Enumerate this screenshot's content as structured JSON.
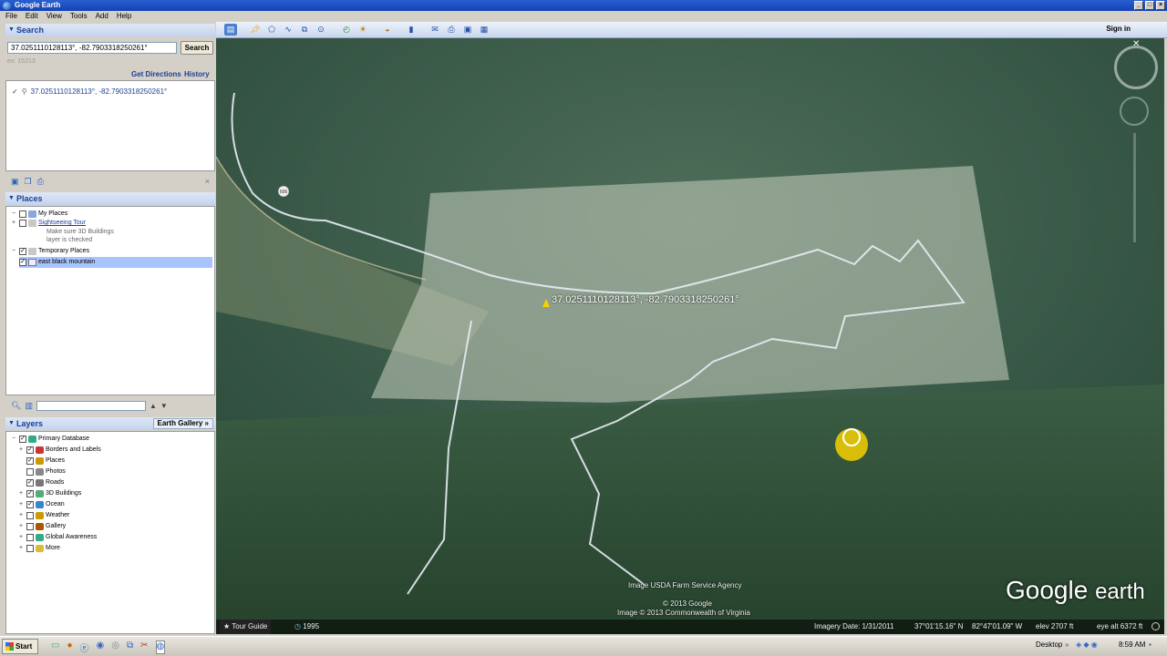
{
  "window": {
    "title": "Google Earth",
    "controls": [
      "_",
      "□",
      "×"
    ]
  },
  "menu": [
    "File",
    "Edit",
    "View",
    "Tools",
    "Add",
    "Help"
  ],
  "search_panel": {
    "title": "Search",
    "query": "37.0251110128113°, -82.7903318250261°",
    "button": "Search",
    "hint": "ex: 15213",
    "get_directions": "Get Directions",
    "history": "History",
    "result": "37.0251110128113°, -82.7903318250261°"
  },
  "places": {
    "title": "Places",
    "my_places": "My Places",
    "sightseeing_tour": "Sightseeing Tour",
    "sightseeing_note_1": "Make sure 3D Buildings",
    "sightseeing_note_2": "layer is checked",
    "temporary_places": "Temporary Places",
    "selected_item": "east black mountain"
  },
  "layers": {
    "title": "Layers",
    "gallery_button": "Earth Gallery",
    "items": [
      {
        "label": "Primary Database",
        "checked": true
      },
      {
        "label": "Borders and Labels",
        "checked": true
      },
      {
        "label": "Places",
        "checked": true
      },
      {
        "label": "Photos",
        "checked": false
      },
      {
        "label": "Roads",
        "checked": true
      },
      {
        "label": "3D Buildings",
        "checked": true
      },
      {
        "label": "Ocean",
        "checked": true
      },
      {
        "label": "Weather",
        "checked": false
      },
      {
        "label": "Gallery",
        "checked": false
      },
      {
        "label": "Global Awareness",
        "checked": false
      },
      {
        "label": "More",
        "checked": false
      }
    ]
  },
  "toolbar": {
    "sign_in": "Sign in"
  },
  "map": {
    "placemark_label": "37.0251110128113°, -82.7903318250261°",
    "road_shield": "606",
    "attribution_1": "Image USDA Farm Service Agency",
    "attribution_2": "© 2013 Google",
    "attribution_3": "Image © 2013 Commonwealth of Virginia",
    "logo_google": "Google",
    "logo_earth": "earth"
  },
  "status": {
    "tour_guide": "Tour Guide",
    "year": "1995",
    "imagery_date": "Imagery Date: 1/31/2011",
    "lat": "37°01'15.16\" N",
    "lon": "82°47'01.09\" W",
    "elev": "elev 2707 ft",
    "eye_alt": "eye alt 6372 ft"
  },
  "taskbar": {
    "start": "Start",
    "desktop": "Desktop",
    "time": "8:59 AM"
  },
  "colors": {
    "selection": "#a8c4ff",
    "panel_header": "#1c3f94",
    "placemark": "#f5d000"
  }
}
